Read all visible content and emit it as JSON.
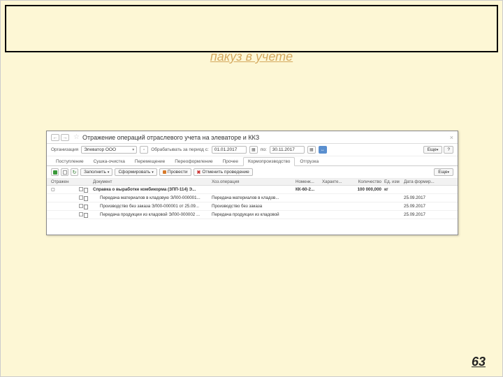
{
  "subtitle": "пакуз в учете",
  "window": {
    "title": "Отражение операций отраслевого учета на элеваторе и ККЗ",
    "org_label": "Организация",
    "org_value": "Элеватор ООО",
    "period_label": "Обрабатывать за период с:",
    "date_from": "01.01.2017",
    "date_to": "30.11.2017",
    "po": "по:",
    "more": "Еще",
    "help": "?",
    "tabs": {
      "t1": "Поступление",
      "t2": "Сушка-очистка",
      "t3": "Перемещение",
      "t4": "Переоформление",
      "t5": "Прочее",
      "t6": "Кормопроизводство",
      "t7": "Отгрузка"
    },
    "toolbar": {
      "fill": "Заполнить",
      "form": "Сформировать",
      "post": "Провести",
      "cancel": "Отменить проведение"
    },
    "columns": {
      "flag": "Отражен",
      "doc": "Документ",
      "op": "Хоз.операция",
      "nom": "Номенк...",
      "char": "Характе...",
      "qty": "Количество",
      "unit": "Ед. изм",
      "date": "Дата формир..."
    },
    "rows": [
      {
        "doc": "Справка о выработке комбикорма (ЗПП-114) Э...",
        "op": "",
        "nom": "КК-60-2...",
        "qty": "100 000,000",
        "unit": "кг",
        "date": "",
        "bold": true
      },
      {
        "doc": "Передача материалов в кладовую ЭЛ00-000001...",
        "op": "Передача материалов в кладов...",
        "nom": "",
        "qty": "",
        "unit": "",
        "date": "25.09.2017"
      },
      {
        "doc": "Производство без заказа ЭЛ00-000001 от 25.09...",
        "op": "Производство без заказа",
        "nom": "",
        "qty": "",
        "unit": "",
        "date": "25.09.2017"
      },
      {
        "doc": "Передача продукции из кладовой ЭЛ00-000002 ...",
        "op": "Передача продукции из кладовой",
        "nom": "",
        "qty": "",
        "unit": "",
        "date": "25.09.2017"
      }
    ]
  },
  "page_num": "63"
}
